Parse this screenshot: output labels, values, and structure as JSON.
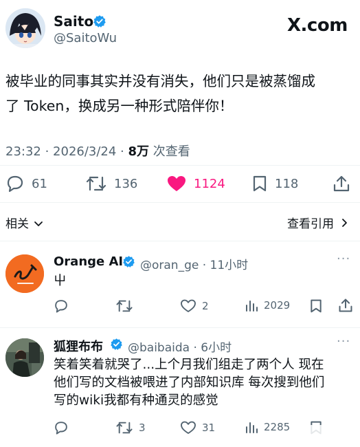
{
  "site_logo": "X.com",
  "main_tweet": {
    "author_name": "Saito",
    "author_handle": "@SaitoWu",
    "body_line1": "被毕业的同事其实并没有消失，他们只是被蒸馏成",
    "body_line2": "了 Token，换成另一种形式陪伴你！",
    "timestamp": "23:32 · 2026/3/24 · ",
    "views_count": "8万",
    "views_label": " 次查看",
    "stats": {
      "replies": "61",
      "retweets": "136",
      "likes": "1124",
      "bookmarks": "118"
    },
    "like_color": "#f91880"
  },
  "related_label": "相关",
  "view_quotes_label": "查看引用",
  "replies": [
    {
      "name": "Orange AI",
      "handle_time": "@oran_ge · 11小时",
      "text": "屮",
      "stats": {
        "replies": "",
        "retweets": "",
        "likes": "2",
        "views": "2029"
      }
    },
    {
      "name": "狐狸布布",
      "handle_time": "@baibaida · 6小时",
      "text_line1": "笑着笑着就哭了...上个月我们组走了两个人 现在",
      "text_line2": "他们写的文档被喂进了内部知识库 每次搜到他们",
      "text_line3": "写的wiki我都有种通灵的感觉",
      "stats": {
        "replies": "",
        "retweets": "3",
        "likes": "31",
        "views": "2285"
      }
    }
  ],
  "icons": {
    "verified": "verified-badge-icon",
    "reply": "reply-icon",
    "retweet": "retweet-icon",
    "like": "heart-icon",
    "bookmark": "bookmark-icon",
    "share": "share-icon",
    "views": "views-icon",
    "more": "more-icon"
  },
  "colors": {
    "verified": "#1d9bf0",
    "secondary_text": "#536471",
    "orange_avatar": "#f26b21"
  }
}
